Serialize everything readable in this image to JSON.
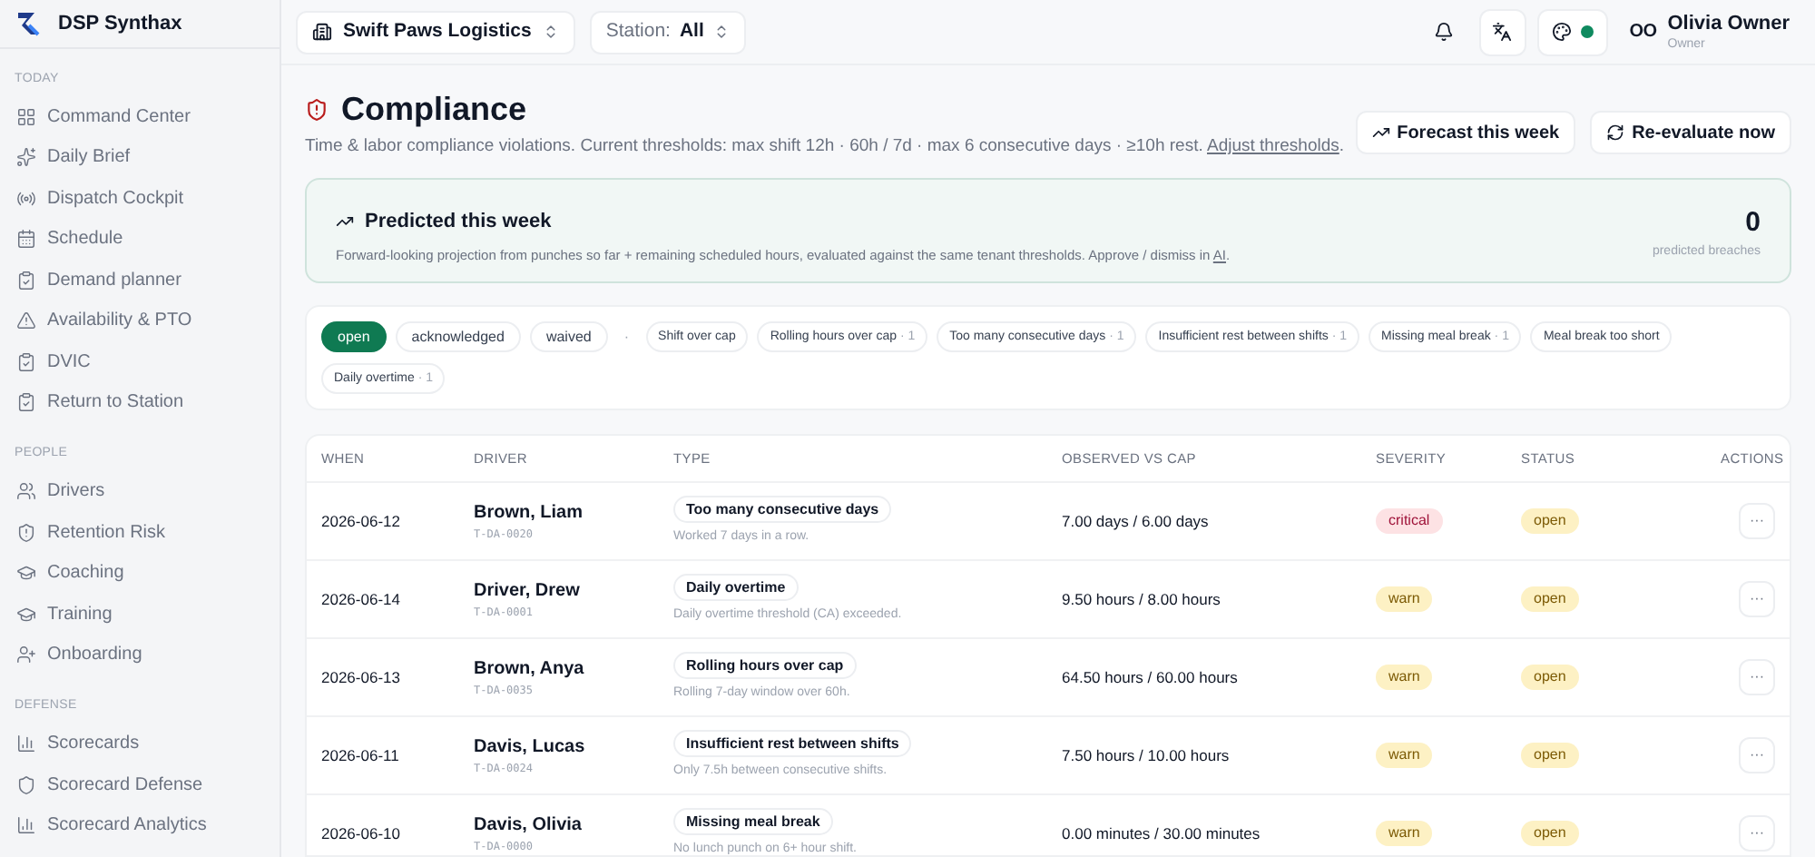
{
  "app": {
    "name": "DSP Synthax"
  },
  "topbar": {
    "tenant": "Swift Paws Logistics",
    "station_label": "Station:",
    "station_value": "All",
    "user": {
      "initials": "OO",
      "name": "Olivia Owner",
      "role": "Owner"
    }
  },
  "sidebar": {
    "sections": [
      {
        "title": "TODAY",
        "items": [
          {
            "label": "Command Center",
            "selected": false
          },
          {
            "label": "Daily Brief",
            "selected": false
          },
          {
            "label": "Dispatch Cockpit",
            "selected": false
          },
          {
            "label": "Schedule",
            "selected": false
          },
          {
            "label": "Demand planner",
            "selected": false
          },
          {
            "label": "Availability & PTO",
            "selected": false
          },
          {
            "label": "DVIC",
            "selected": false
          },
          {
            "label": "Return to Station",
            "selected": false
          }
        ]
      },
      {
        "title": "PEOPLE",
        "items": [
          {
            "label": "Drivers",
            "selected": false
          },
          {
            "label": "Retention Risk",
            "selected": false
          },
          {
            "label": "Coaching",
            "selected": false
          },
          {
            "label": "Training",
            "selected": false
          },
          {
            "label": "Onboarding",
            "selected": false
          }
        ]
      },
      {
        "title": "DEFENSE",
        "items": [
          {
            "label": "Scorecards",
            "selected": false
          },
          {
            "label": "Scorecard Defense",
            "selected": false
          },
          {
            "label": "Scorecard Analytics",
            "selected": false
          }
        ]
      }
    ]
  },
  "page": {
    "title": "Compliance",
    "subtitle": "Time & labor compliance violations. Current thresholds: max shift 12h · 60h / 7d · max 6 consecutive days · ≥10h rest.",
    "subtitle_link": "Adjust thresholds",
    "subtitle_end": ".",
    "buttons": [
      "Forecast this week",
      "Re-evaluate now"
    ]
  },
  "prediction": {
    "title": "Predicted this week",
    "text": "Forward-looking projection from punches so far + remaining scheduled hours, evaluated against the same tenant thresholds. Approve / dismiss in",
    "link": "AI",
    "text_end": ".",
    "count": "0",
    "count_label": "predicted breaches"
  },
  "filters": {
    "status": [
      {
        "label": "open",
        "selected": true
      },
      {
        "label": "acknowledged",
        "selected": false
      },
      {
        "label": "waived",
        "selected": false
      }
    ],
    "separator": "·",
    "types": [
      {
        "label": "Shift over cap"
      },
      {
        "label": "Rolling hours over cap",
        "count": "· 1"
      },
      {
        "label": "Too many consecutive days",
        "count": "· 1"
      },
      {
        "label": "Insufficient rest between shifts",
        "count": "· 1"
      },
      {
        "label": "Missing meal break",
        "count": "· 1"
      },
      {
        "label": "Meal break too short"
      },
      {
        "label": "Daily overtime",
        "count": "· 1"
      }
    ]
  },
  "table": {
    "columns": [
      "WHEN",
      "DRIVER",
      "TYPE",
      "OBSERVED VS CAP",
      "SEVERITY",
      "STATUS",
      "ACTIONS"
    ],
    "rows": [
      {
        "when": "2026-06-12",
        "driver": "Brown, Liam",
        "driver_id": "T-DA-0020",
        "type": "Too many consecutive days",
        "detail": "Worked 7 days in a row.",
        "observed": "7.00 days / 6.00 days",
        "severity": {
          "label": "critical",
          "kind": "critical"
        },
        "status": {
          "label": "open",
          "kind": "open"
        },
        "action": "···"
      },
      {
        "when": "2026-06-14",
        "driver": "Driver, Drew",
        "driver_id": "T-DA-0001",
        "type": "Daily overtime",
        "detail": "Daily overtime threshold (CA) exceeded.",
        "observed": "9.50 hours / 8.00 hours",
        "severity": {
          "label": "warn",
          "kind": "warn"
        },
        "status": {
          "label": "open",
          "kind": "open"
        },
        "action": "···"
      },
      {
        "when": "2026-06-13",
        "driver": "Brown, Anya",
        "driver_id": "T-DA-0035",
        "type": "Rolling hours over cap",
        "detail": "Rolling 7-day window over 60h.",
        "observed": "64.50 hours / 60.00 hours",
        "severity": {
          "label": "warn",
          "kind": "warn"
        },
        "status": {
          "label": "open",
          "kind": "open"
        },
        "action": "···"
      },
      {
        "when": "2026-06-11",
        "driver": "Davis, Lucas",
        "driver_id": "T-DA-0024",
        "type": "Insufficient rest between shifts",
        "detail": "Only 7.5h between consecutive shifts.",
        "observed": "7.50 hours / 10.00 hours",
        "severity": {
          "label": "warn",
          "kind": "warn"
        },
        "status": {
          "label": "open",
          "kind": "open"
        },
        "action": "···"
      },
      {
        "when": "2026-06-10",
        "driver": "Davis, Olivia",
        "driver_id": "T-DA-0000",
        "type": "Missing meal break",
        "detail": "No lunch punch on 6+ hour shift.",
        "observed": "0.00 minutes / 30.00 minutes",
        "severity": {
          "label": "warn",
          "kind": "warn"
        },
        "status": {
          "label": "open",
          "kind": "open"
        },
        "action": "···"
      }
    ]
  }
}
